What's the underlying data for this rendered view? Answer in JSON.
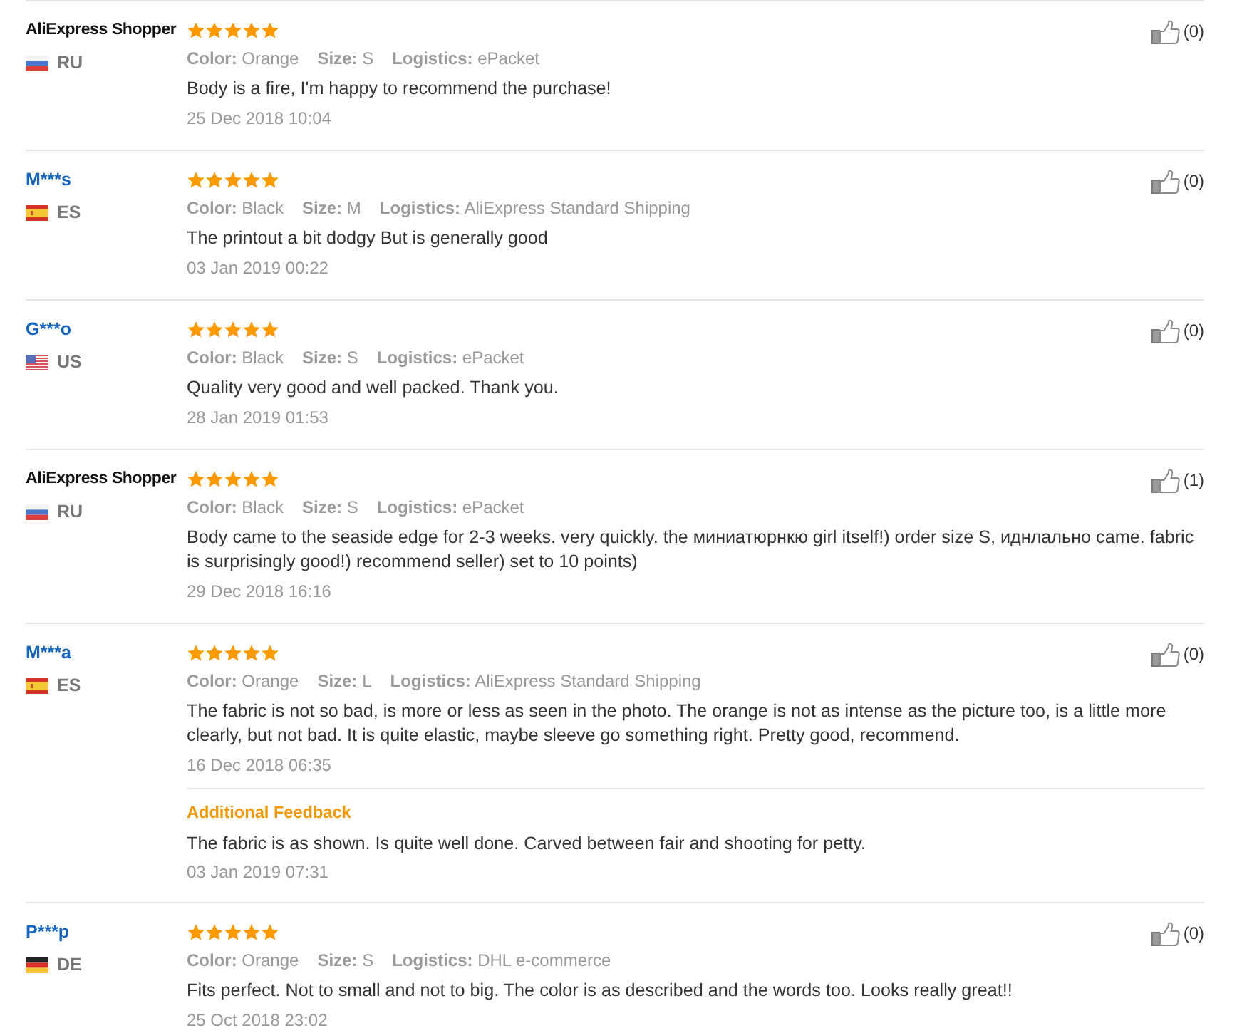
{
  "reviews": [
    {
      "name": "AliExpress Shopper",
      "linked": false,
      "country": "RU",
      "stars": 5,
      "likes": "(0)",
      "attributes": [
        {
          "label": "Color:",
          "value": "Orange"
        },
        {
          "label": "Size:",
          "value": "S"
        },
        {
          "label": "Logistics:",
          "value": "ePacket"
        }
      ],
      "text": "Body is a fire, I'm happy to recommend the purchase!",
      "date": "25 Dec 2018 10:04"
    },
    {
      "name": "M***s",
      "linked": true,
      "country": "ES",
      "stars": 5,
      "likes": "(0)",
      "attributes": [
        {
          "label": "Color:",
          "value": "Black"
        },
        {
          "label": "Size:",
          "value": "M"
        },
        {
          "label": "Logistics:",
          "value": "AliExpress Standard Shipping"
        }
      ],
      "text": "The printout a bit dodgy But is generally good",
      "date": "03 Jan 2019 00:22"
    },
    {
      "name": "G***o",
      "linked": true,
      "country": "US",
      "stars": 5,
      "likes": "(0)",
      "attributes": [
        {
          "label": "Color:",
          "value": "Black"
        },
        {
          "label": "Size:",
          "value": "S"
        },
        {
          "label": "Logistics:",
          "value": "ePacket"
        }
      ],
      "text": "Quality very good and well packed. Thank you.",
      "date": "28 Jan 2019 01:53"
    },
    {
      "name": "AliExpress Shopper",
      "linked": false,
      "country": "RU",
      "stars": 5,
      "likes": "(1)",
      "attributes": [
        {
          "label": "Color:",
          "value": "Black"
        },
        {
          "label": "Size:",
          "value": "S"
        },
        {
          "label": "Logistics:",
          "value": "ePacket"
        }
      ],
      "text": "Body came to the seaside edge for 2-3 weeks. very quickly. the миниатюрнкю girl itself!) order size S, иднлально came. fabric is surprisingly good!) recommend seller) set to 10 points)",
      "date": "29 Dec 2018 16:16"
    },
    {
      "name": "M***a",
      "linked": true,
      "country": "ES",
      "stars": 5,
      "likes": "(0)",
      "attributes": [
        {
          "label": "Color:",
          "value": "Orange"
        },
        {
          "label": "Size:",
          "value": "L"
        },
        {
          "label": "Logistics:",
          "value": "AliExpress Standard Shipping"
        }
      ],
      "text": "The fabric is not so bad, is more or less as seen in the photo. The orange is not as intense as the picture too, is a little more clearly, but not bad. It is quite elastic, maybe sleeve go something right. Pretty good, recommend.",
      "date": "16 Dec 2018 06:35",
      "additional_feedback": {
        "title": "Additional Feedback",
        "text": "The fabric is as shown. Is quite well done. Carved between fair and shooting for petty.",
        "date": "03 Jan 2019 07:31"
      }
    },
    {
      "name": "P***p",
      "linked": true,
      "country": "DE",
      "stars": 5,
      "likes": "(0)",
      "attributes": [
        {
          "label": "Color:",
          "value": "Orange"
        },
        {
          "label": "Size:",
          "value": "S"
        },
        {
          "label": "Logistics:",
          "value": "DHL e-commerce"
        }
      ],
      "text": "Fits perfect. Not to small and not to big. The color is as described and the words too. Looks really great!!",
      "date": "25 Oct 2018 23:02"
    }
  ]
}
